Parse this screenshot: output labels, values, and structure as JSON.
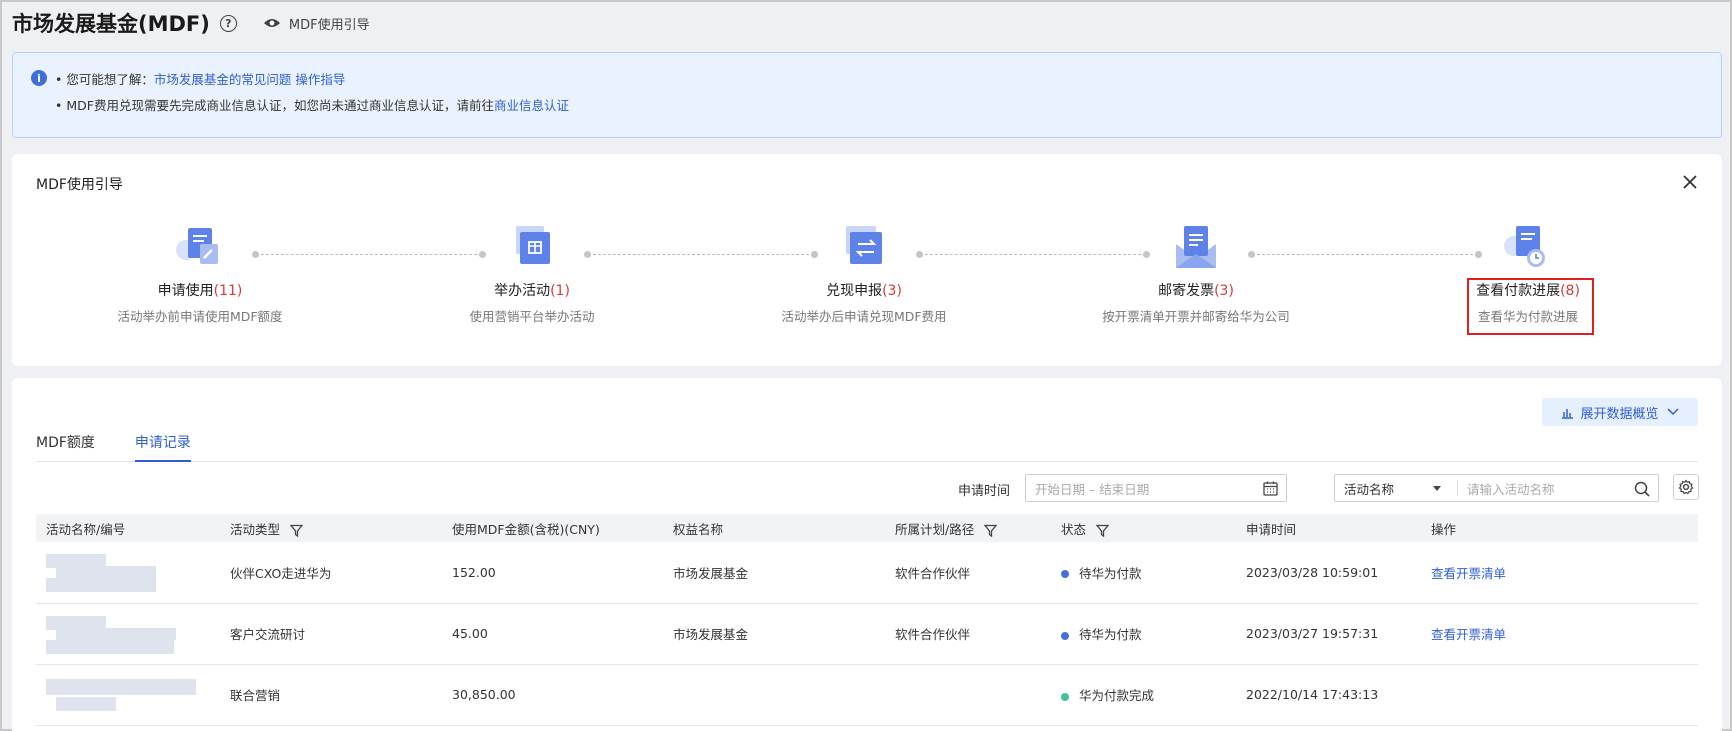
{
  "header": {
    "title": "市场发展基金(MDF)",
    "help_icon": "question-circle-icon",
    "guide_link": "MDF使用引导"
  },
  "notice": {
    "line1_prefix": "• 您可能想了解：",
    "line1_link1": "市场发展基金的常见问题",
    "line1_link2": "操作指导",
    "line2_prefix": "• MDF费用兑现需要先完成商业信息认证，如您尚未通过商业信息认证，请前往",
    "line2_link": "商业信息认证"
  },
  "guide": {
    "title": "MDF使用引导",
    "steps": [
      {
        "label": "申请使用",
        "count": "(11)",
        "desc": "活动举办前申请使用MDF额度",
        "icon": "apply-form-icon"
      },
      {
        "label": "举办活动",
        "count": "(1)",
        "desc": "使用营销平台举办活动",
        "icon": "activity-calendar-icon"
      },
      {
        "label": "兑现申报",
        "count": "(3)",
        "desc": "活动举办后申请兑现MDF费用",
        "icon": "exchange-icon"
      },
      {
        "label": "邮寄发票",
        "count": "(3)",
        "desc": "按开票清单开票并邮寄给华为公司",
        "icon": "mail-invoice-icon"
      },
      {
        "label": "查看付款进展",
        "count": "(8)",
        "desc": "查看华为付款进展",
        "icon": "payment-progress-icon"
      }
    ]
  },
  "records": {
    "expand_button": "展开数据概览",
    "tabs": [
      "MDF额度",
      "申请记录"
    ],
    "active_tab": 1,
    "filter": {
      "time_label": "申请时间",
      "date_placeholder": "开始日期 – 结束日期",
      "select_value": "活动名称",
      "search_placeholder": "请输入活动名称"
    },
    "columns": [
      "活动名称/编号",
      "活动类型",
      "使用MDF金额(含税)(CNY)",
      "权益名称",
      "所属计划/路径",
      "状态",
      "申请时间",
      "操作"
    ],
    "rows": [
      {
        "type": "伙伴CXO走进华为",
        "amount": "152.00",
        "benefit": "市场发展基金",
        "plan": "软件合作伙伴",
        "status": "待华为付款",
        "status_color": "#4a6fd8",
        "time": "2023/03/28 10:59:01",
        "action": "查看开票清单"
      },
      {
        "type": "客户交流研讨",
        "amount": "45.00",
        "benefit": "市场发展基金",
        "plan": "软件合作伙伴",
        "status": "待华为付款",
        "status_color": "#4a6fd8",
        "time": "2023/03/27 19:57:31",
        "action": "查看开票清单"
      },
      {
        "type": "联合营销",
        "amount": "30,850.00",
        "benefit": "",
        "plan": "",
        "status": "华为付款完成",
        "status_color": "#3fc494",
        "time": "2022/10/14 17:43:13",
        "action": ""
      }
    ]
  }
}
